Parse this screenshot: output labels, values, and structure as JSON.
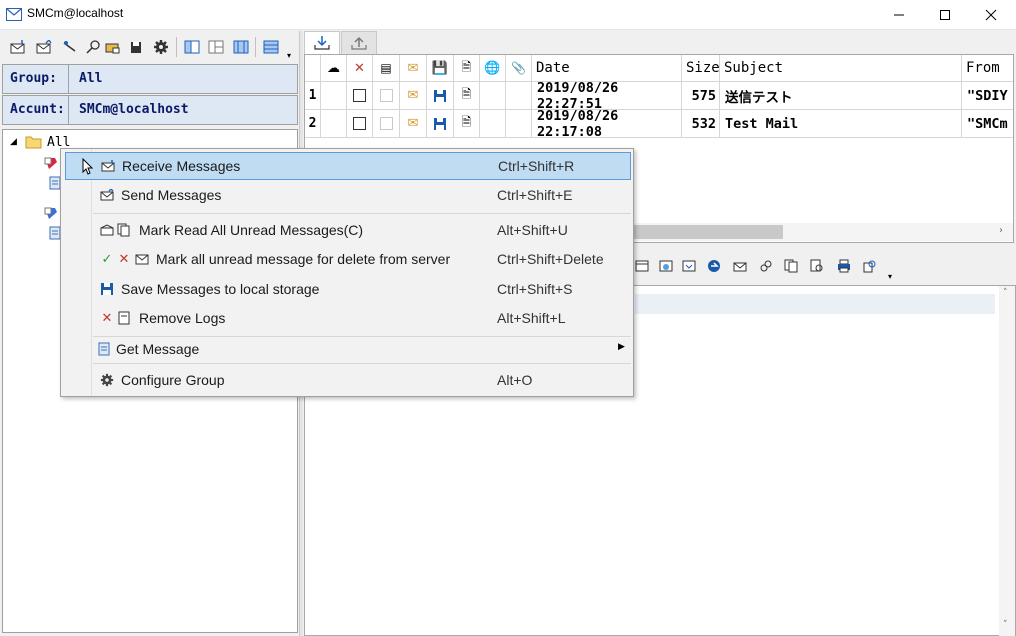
{
  "window": {
    "title": "SMCm@localhost",
    "controls": {
      "minimize": "minimize-icon",
      "maximize": "maximize-icon",
      "close": "close-icon"
    }
  },
  "left_toolbar": {
    "icons": [
      "receive-icon",
      "send-icon",
      "wand-icon",
      "search-icon",
      "folder-icon",
      "save-disk-icon",
      "gear-icon",
      "layout-left-icon",
      "layout-split-icon",
      "layout-columns-icon",
      "list-view-icon"
    ]
  },
  "group": {
    "label": "Group:",
    "value": "All"
  },
  "account": {
    "label": "Accunt:",
    "value": "SMCm@localhost"
  },
  "tree": {
    "root_label": "All"
  },
  "tabs": [
    {
      "name": "inbox-tab",
      "icon": "download-icon",
      "active": true
    },
    {
      "name": "outbox-tab",
      "icon": "upload-icon",
      "active": false
    }
  ],
  "message_list": {
    "columns": {
      "date": "Date",
      "size": "Size",
      "subject": "Subject",
      "from": "From"
    },
    "rows": [
      {
        "num": "1",
        "date": "2019/08/26 22:27:51",
        "size": "575",
        "subject": "送信テスト",
        "from": "\"SDIY"
      },
      {
        "num": "2",
        "date": "2019/08/26 22:17:08",
        "size": "532",
        "subject": "Test Mail",
        "from": "\"SMCm"
      }
    ]
  },
  "context_menu": {
    "items": [
      {
        "label": "Receive Messages",
        "shortcut": "Ctrl+Shift+R"
      },
      {
        "label": "Send Messages",
        "shortcut": "Ctrl+Shift+E"
      },
      {
        "label": "Mark Read All Unread Messages(C)",
        "shortcut": "Alt+Shift+U"
      },
      {
        "label": "Mark all unread message for delete from server",
        "shortcut": "Ctrl+Shift+Delete"
      },
      {
        "label": "Save Messages to local storage",
        "shortcut": "Ctrl+Shift+S"
      },
      {
        "label": "Remove Logs",
        "shortcut": "Alt+Shift+L"
      },
      {
        "label": "Get Message",
        "shortcut": ""
      },
      {
        "label": "Configure Group",
        "shortcut": "Alt+O"
      }
    ]
  },
  "colors": {
    "accent": "#0078d7",
    "field_bg": "#dde8f4",
    "menu_highlight": "#c0dcf3",
    "field_text": "#0b1a66"
  }
}
